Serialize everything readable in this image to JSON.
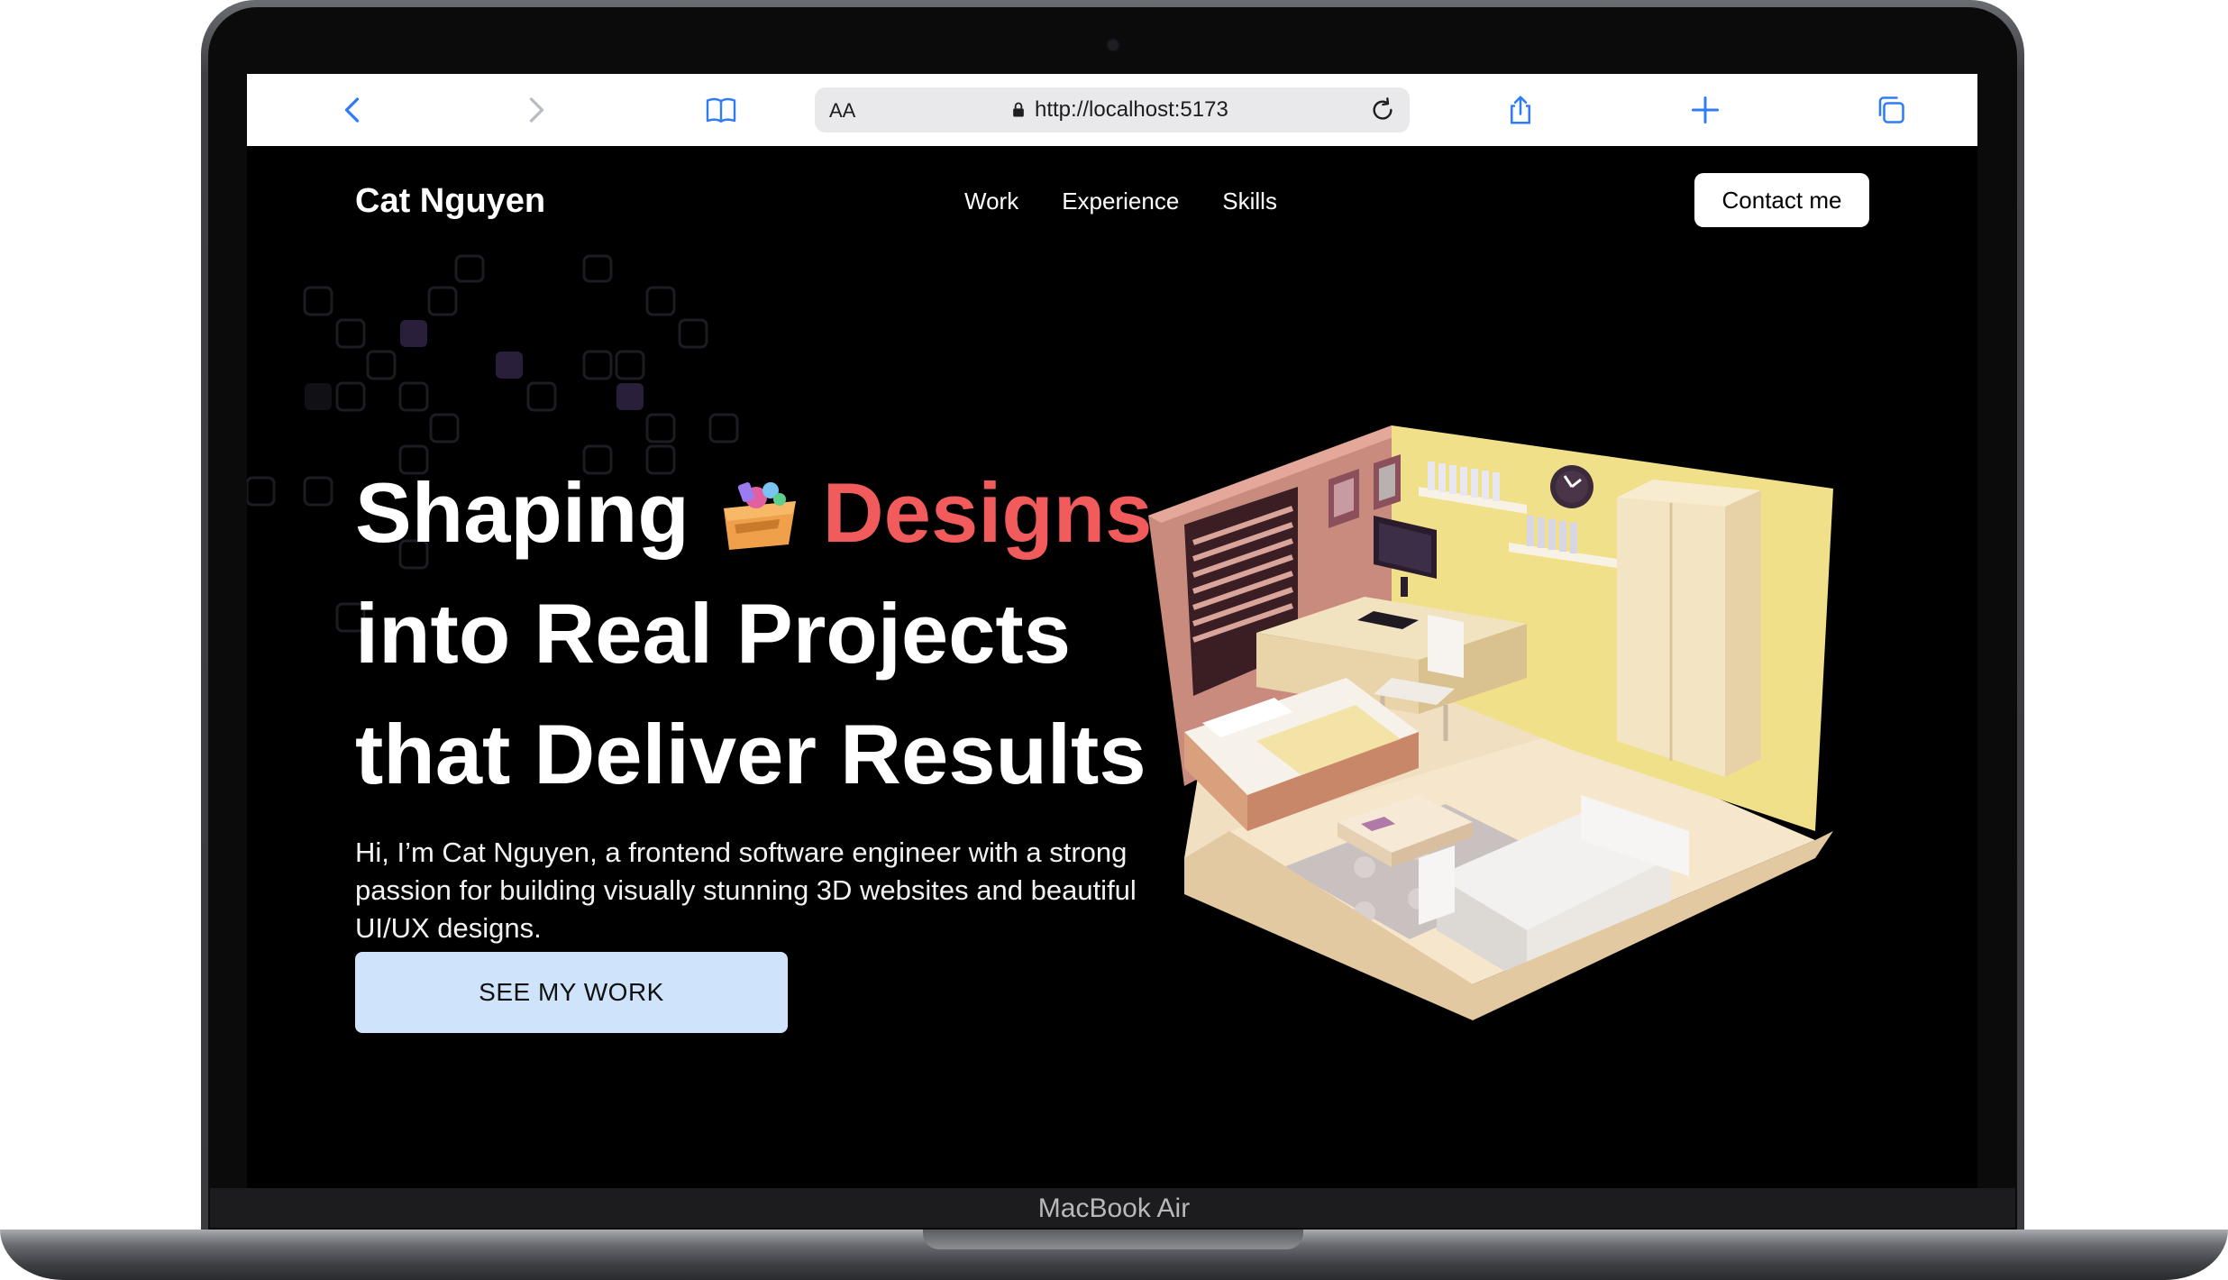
{
  "browser": {
    "text_size_label": "AA",
    "url": "http://localhost:5173"
  },
  "site": {
    "logo": "Cat Nguyen",
    "nav": [
      "Work",
      "Experience",
      "Skills"
    ],
    "contact_label": "Contact me",
    "headline": {
      "line1_prefix": "Shaping",
      "line1_accent": "Designs",
      "line2": "into Real Projects",
      "line3": "that Deliver Results"
    },
    "intro": "Hi, I’m Cat Nguyen, a frontend software engineer with a strong passion for building visually stunning 3D websites and beautiful UI/UX designs.",
    "cta_label": "SEE MY WORK"
  },
  "device": {
    "label": "MacBook Air"
  },
  "colors": {
    "accent": "#f25b5b",
    "cta_bg": "#cfe4fb",
    "safari_blue": "#2f7cf6"
  }
}
